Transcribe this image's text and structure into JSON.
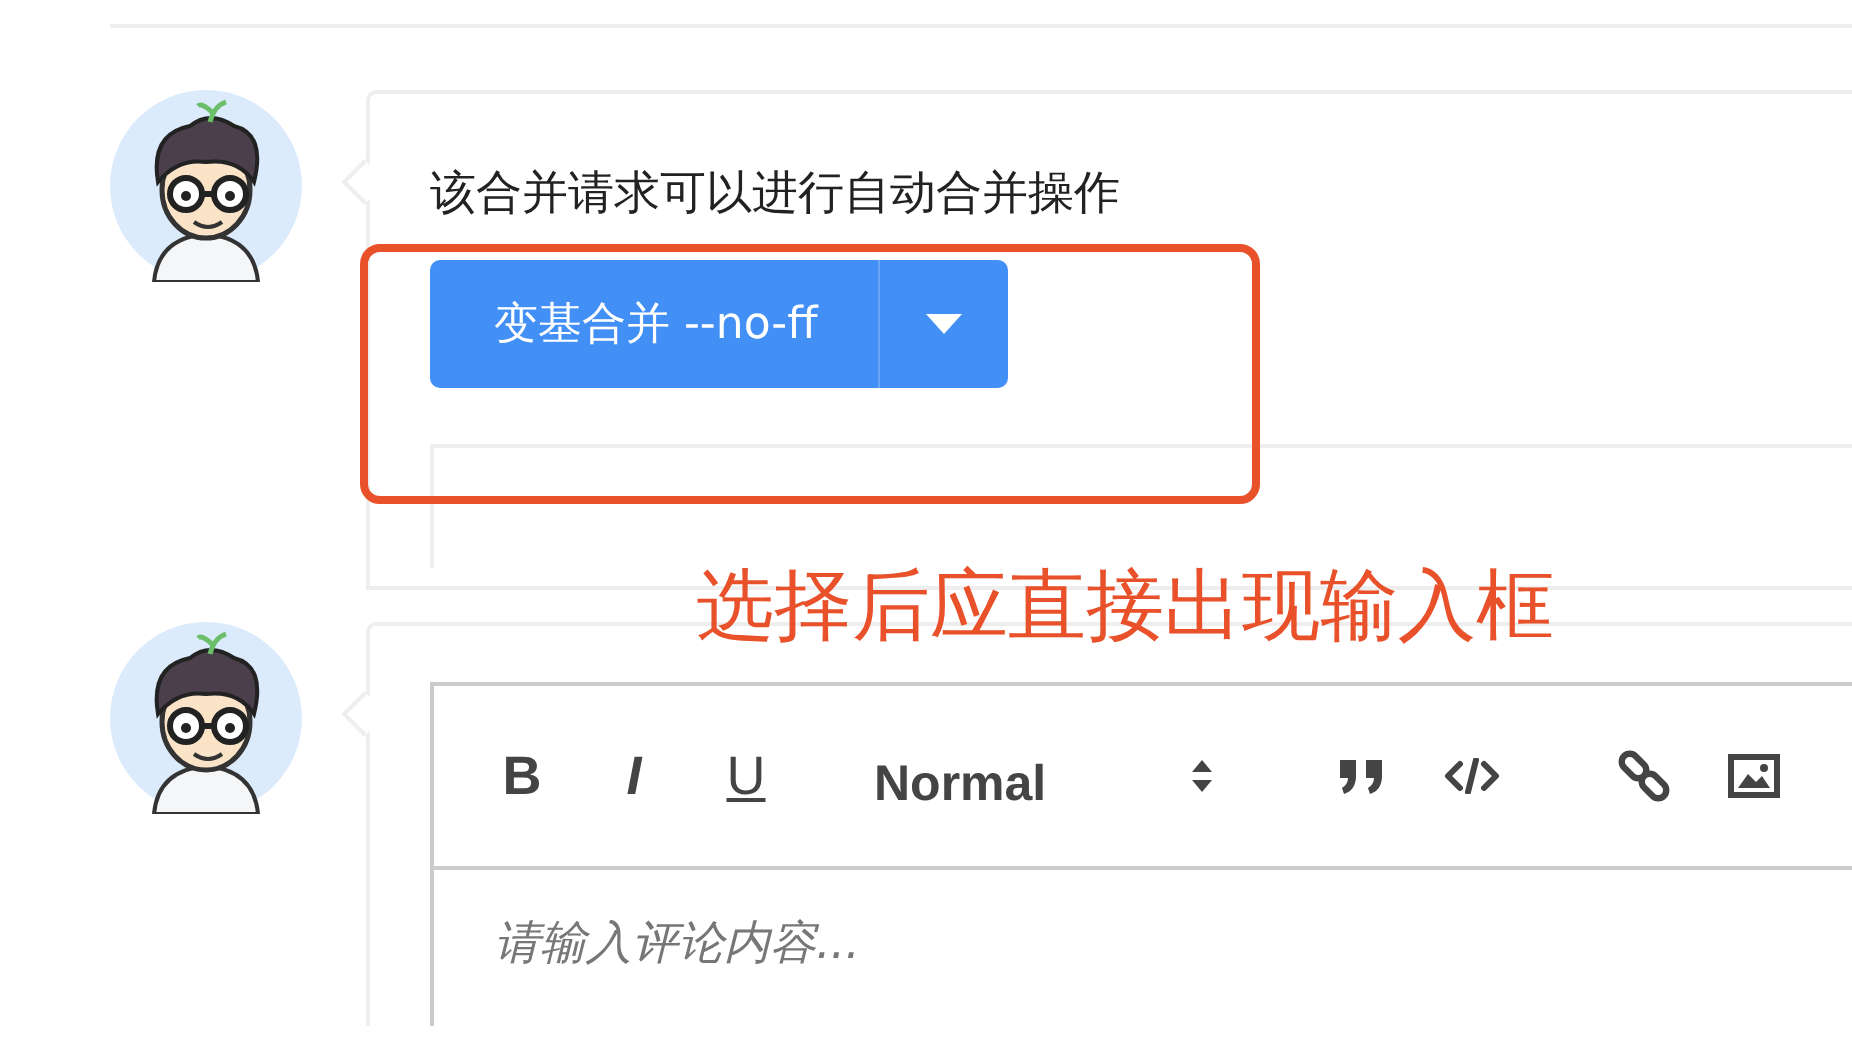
{
  "comments": [
    {
      "kind": "merge",
      "message": "该合并请求可以进行自动合并操作",
      "merge_button": {
        "label": "变基合并 --no-ff"
      }
    },
    {
      "kind": "editor",
      "toolbar": {
        "bold": "B",
        "italic": "I",
        "underline": "U",
        "heading": "Normal"
      },
      "placeholder": "请输入评论内容..."
    }
  ],
  "annotation": {
    "text": "选择后应直接出现输入框"
  }
}
